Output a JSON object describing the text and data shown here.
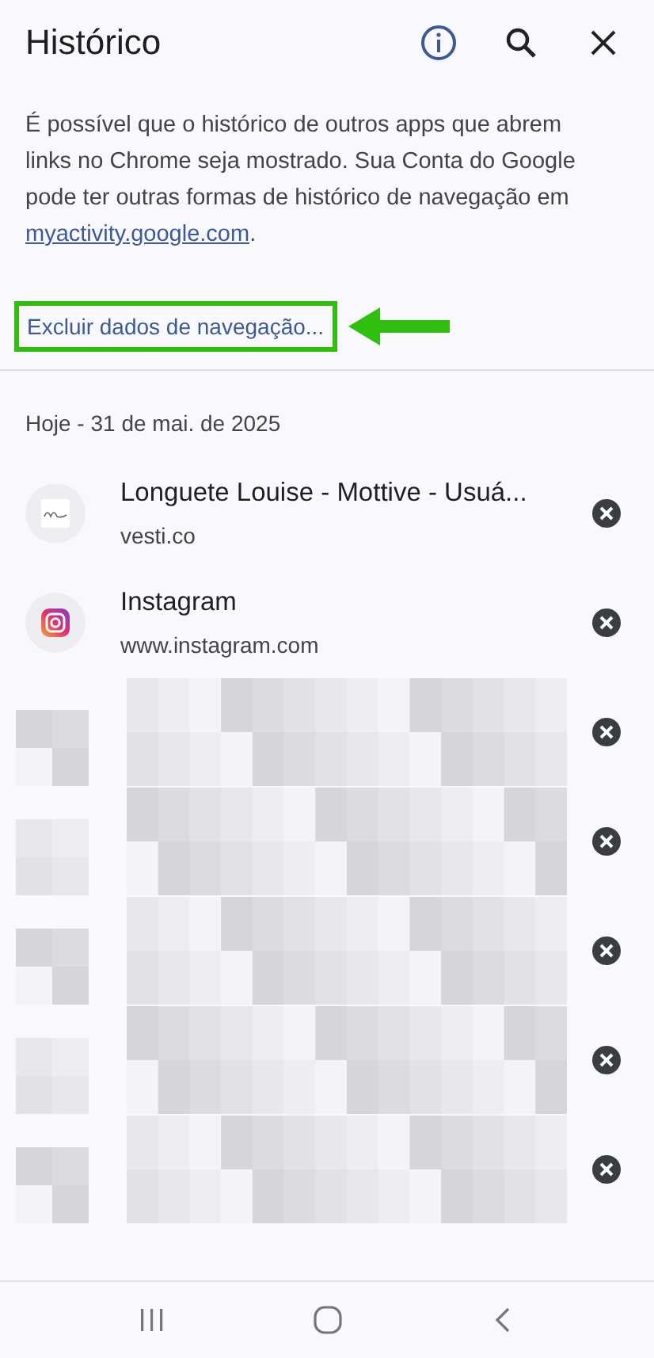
{
  "header": {
    "title": "Histórico"
  },
  "notice": {
    "text": "É possível que o histórico de outros apps que abrem links no Chrome seja mostrado. Sua Conta do Google pode ter outras formas de histórico de navegação em ",
    "link": "myactivity.google.com",
    "end": "."
  },
  "clear_link": {
    "label": "Excluir dados de navegação...",
    "highlighted": true
  },
  "section": {
    "date": "Hoje - 31 de mai. de 2025"
  },
  "entries": [
    {
      "kind": "site",
      "title": "Longuete Louise - Mottive - Usuá...",
      "url": "vesti.co"
    },
    {
      "kind": "site",
      "title": "Instagram",
      "url": "www.instagram.com"
    },
    {
      "kind": "redacted"
    },
    {
      "kind": "redacted"
    },
    {
      "kind": "redacted"
    },
    {
      "kind": "redacted"
    },
    {
      "kind": "redacted"
    }
  ]
}
